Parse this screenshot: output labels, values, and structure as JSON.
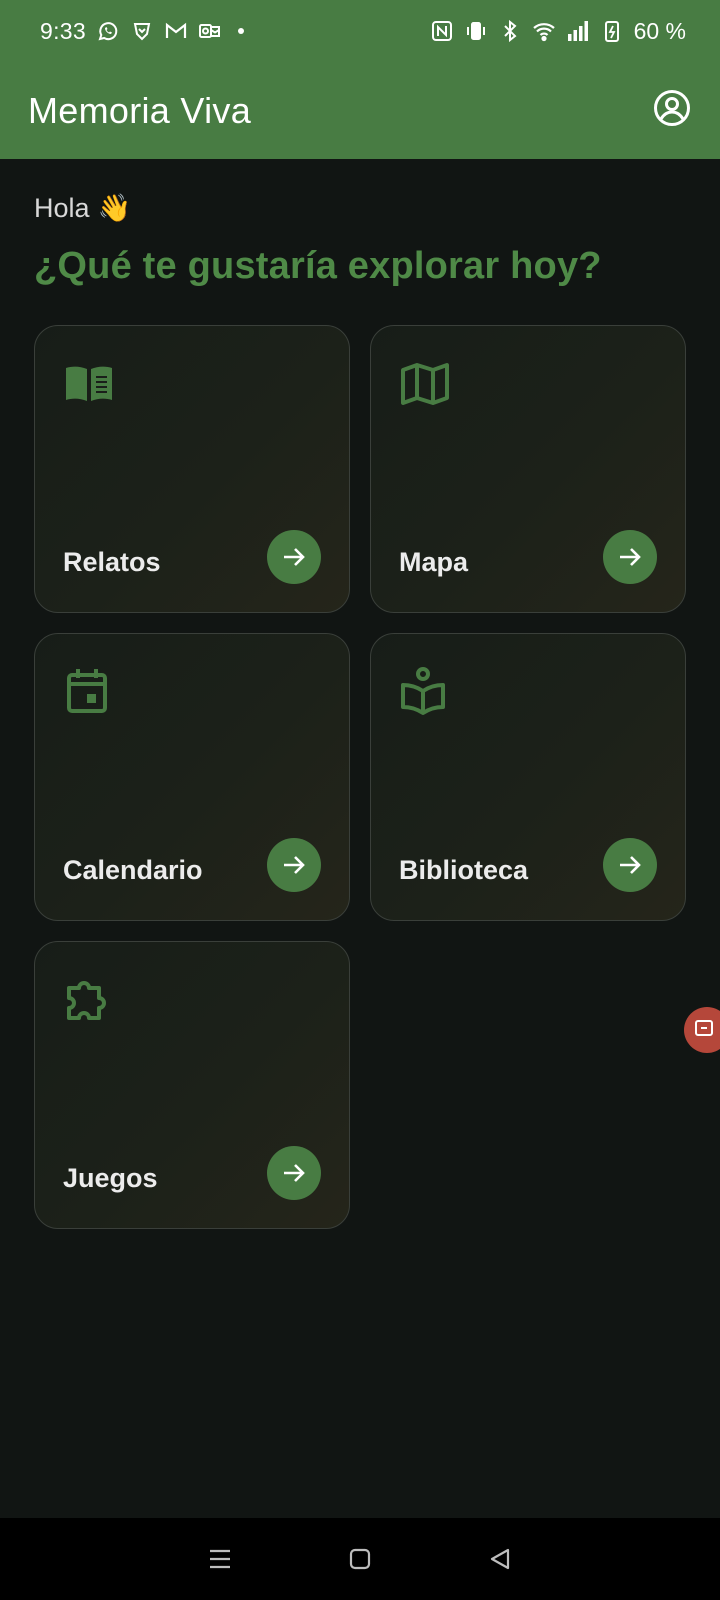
{
  "status_bar": {
    "time": "9:33",
    "battery": "60 %",
    "left_icons": [
      "whatsapp-icon",
      "brave-icon",
      "gmail-icon",
      "outlook-icon"
    ],
    "right_icons": [
      "nfc-icon",
      "vibrate-icon",
      "bluetooth-icon",
      "wifi-icon",
      "signal-icon",
      "battery-charging-icon"
    ]
  },
  "app_bar": {
    "title": "Memoria Viva",
    "profile_icon": "account-circle-icon"
  },
  "greeting": {
    "text": "Hola",
    "emoji": "👋"
  },
  "prompt": "¿Qué te gustaría explorar hoy?",
  "cards": [
    {
      "label": "Relatos",
      "icon": "book-open-icon"
    },
    {
      "label": "Mapa",
      "icon": "map-icon"
    },
    {
      "label": "Calendario",
      "icon": "calendar-icon"
    },
    {
      "label": "Biblioteca",
      "icon": "reading-person-icon"
    },
    {
      "label": "Juegos",
      "icon": "puzzle-icon"
    }
  ],
  "colors": {
    "primary": "#487c43",
    "accent_text": "#4f8a47",
    "background": "#111513",
    "record_button": "#b5473a"
  }
}
